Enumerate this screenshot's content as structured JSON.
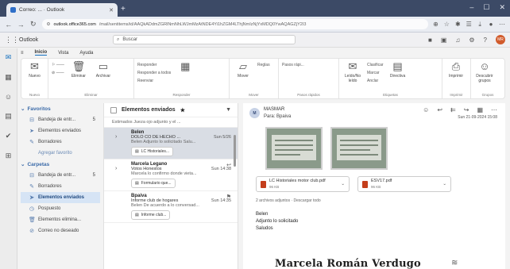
{
  "browser": {
    "tab_title": "Correo: ... · Outlook",
    "new_tab": "+",
    "url_host": "outlook.office365.com",
    "url_rest": "/mail/sentitems/id/AAQkADdmZGRlNmNhLWJmMzAtNDE4Yi1hZGM4LThjNmIzNjYxMDQ0YwAQAGZjY2I3",
    "win_controls": [
      "–",
      "☐",
      "✕"
    ]
  },
  "outlook": {
    "app_name": "Outlook",
    "search_placeholder": "Buscar",
    "ribbon_tabs": [
      "Inicio",
      "Vista",
      "Ayuda"
    ],
    "ribbon": {
      "nuevo": "Nuevo",
      "eliminar": "Eliminar",
      "archivar": "Archivar",
      "responder": "Responder",
      "responder_todos": "Responder a todos",
      "reenviar": "Reenviar",
      "mover": "Mover",
      "reglas": "Reglas",
      "pasos_rapidos": "Pasos rápi...",
      "leido": "Leído/No leído",
      "clasificar": "Clasificar",
      "marcar": "Marcar",
      "anclar": "Anclar",
      "directiva": "Directiva",
      "imprimir": "Imprimir",
      "descubrir": "Descubrir grupos",
      "groups": [
        "Nuevo",
        "Eliminar",
        "Responder",
        "Mover",
        "Pasos rápidos",
        "Etiquetas",
        "Imprimir",
        "Grupos"
      ]
    }
  },
  "folders": {
    "favoritos": "Favoritos",
    "fav_items": [
      {
        "label": "Bandeja de entr...",
        "count": "5"
      },
      {
        "label": "Elementos enviados",
        "count": ""
      },
      {
        "label": "Borradores",
        "count": ""
      }
    ],
    "add_favorite": "Agregar favorito",
    "carpetas": "Carpetas",
    "items": [
      {
        "label": "Bandeja de entr...",
        "count": "5"
      },
      {
        "label": "Borradores",
        "count": ""
      },
      {
        "label": "Elementos enviados",
        "count": ""
      },
      {
        "label": "Pospuesto",
        "count": ""
      },
      {
        "label": "Elementos elimina...",
        "count": ""
      },
      {
        "label": "Correo no deseado",
        "count": ""
      }
    ]
  },
  "list": {
    "header": "Elementos enviados",
    "first_preview": "Estimados Jueza ojo adjunto y el ...",
    "messages": [
      {
        "from": "Belen",
        "subject": "DOLO CO DE HECHO ...",
        "time": "Sun 5/26",
        "preview": "Belen Adjunto lo solicitado Salu...",
        "chip": "LC Historiales...",
        "selected": true
      },
      {
        "from": "Marcela Legano",
        "subject": "Votos Honestos",
        "time": "Sun 14:38",
        "preview": "Marcela lo confirmo donde vieta...",
        "chip": "Formulario que..."
      },
      {
        "from": "Bpaiva",
        "subject": "Informe club de hogares",
        "time": "Sun 14:35",
        "preview": "Belen De acuerdo a lo conversad...",
        "chip": "Informe club..."
      }
    ]
  },
  "reading": {
    "sender_initials": "M",
    "sender_name": "MASMAR",
    "to": "Para: Bpaiva",
    "date": "Sun 21-09-2024 15:08",
    "attachments": [
      {
        "name": "LC Historiales motor club.pdf",
        "size": "96 KB"
      },
      {
        "name": "ESV17.pdf",
        "size": "96 KB"
      }
    ],
    "attachment_info": "2 archivos adjuntos · Descargar todo",
    "body": [
      "Belen",
      "Adjunto lo solicitado",
      "Saludos"
    ],
    "signature": "Marcela Román Verdugo"
  }
}
